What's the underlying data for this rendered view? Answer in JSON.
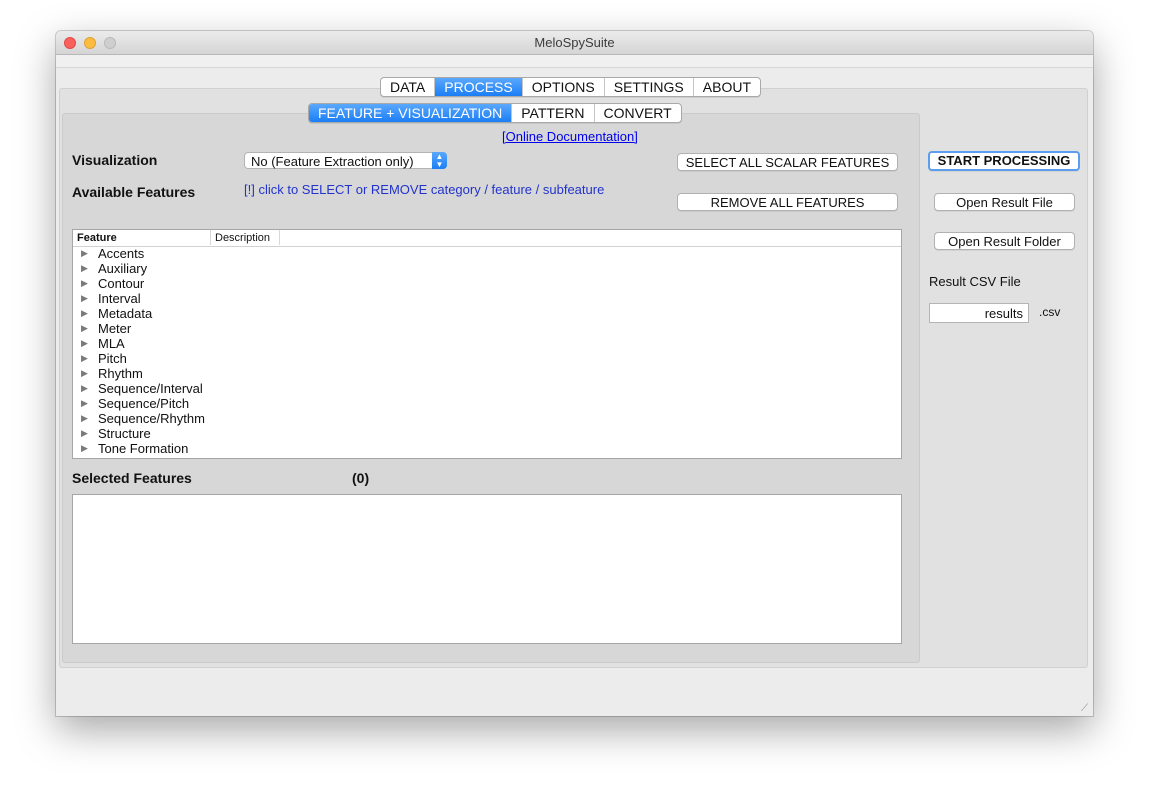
{
  "window": {
    "title": "MeloSpySuite"
  },
  "main_tabs": [
    {
      "label": "DATA",
      "active": false
    },
    {
      "label": "PROCESS",
      "active": true
    },
    {
      "label": "OPTIONS",
      "active": false
    },
    {
      "label": "SETTINGS",
      "active": false
    },
    {
      "label": "ABOUT",
      "active": false
    }
  ],
  "sub_tabs": [
    {
      "label": "FEATURE + VISUALIZATION",
      "active": true
    },
    {
      "label": "PATTERN",
      "active": false
    },
    {
      "label": "CONVERT",
      "active": false
    }
  ],
  "online_doc_link": "[Online Documentation]",
  "visualization": {
    "label": "Visualization",
    "selected": "No (Feature Extraction only)"
  },
  "available_features": {
    "label": "Available Features",
    "hint": "[!] click to SELECT or REMOVE category / feature / subfeature"
  },
  "buttons": {
    "select_all_scalar": "SELECT ALL SCALAR FEATURES",
    "remove_all": "REMOVE ALL FEATURES",
    "start_processing": "START PROCESSING",
    "open_result_file": "Open Result File",
    "open_result_folder": "Open Result Folder"
  },
  "tree": {
    "columns": [
      "Feature",
      "Description"
    ],
    "items": [
      "Accents",
      "Auxiliary",
      "Contour",
      "Interval",
      "Metadata",
      "Meter",
      "MLA",
      "Pitch",
      "Rhythm",
      "Sequence/Interval",
      "Sequence/Pitch",
      "Sequence/Rhythm",
      "Structure",
      "Tone Formation"
    ]
  },
  "selected_features": {
    "label": "Selected Features",
    "count": "(0)"
  },
  "result_csv": {
    "label": "Result CSV File",
    "value": "results",
    "extension": ".csv"
  },
  "colors": {
    "accent": "#1b7ef5",
    "link": "#0000ee"
  },
  "icons": {
    "disclosure": "disclosure-triangle-icon",
    "popup_arrows": "updown-chevron-icon",
    "resize": "resize-grip-icon"
  }
}
